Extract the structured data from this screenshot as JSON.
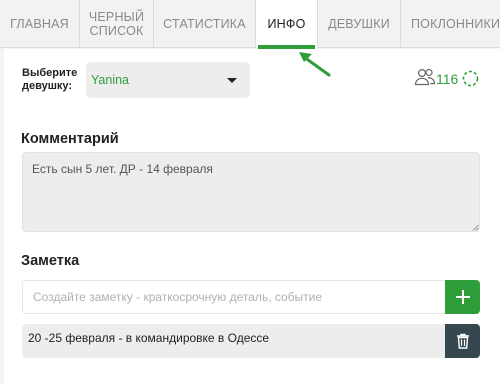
{
  "tabs": [
    {
      "label": "ГЛАВНАЯ",
      "active": false
    },
    {
      "label": "ЧЕРНЫЙ",
      "label2": "СПИСОК",
      "active": false
    },
    {
      "label": "СТАТИСТИКА",
      "active": false
    },
    {
      "label": "ИНФО",
      "active": true
    },
    {
      "label": "ДЕВУШКИ",
      "active": false
    },
    {
      "label": "ПОКЛОННИКИ",
      "active": false
    }
  ],
  "girl_select": {
    "label": "Выберите девушку:",
    "value": "Yanina"
  },
  "stats": {
    "icon": "people-icon",
    "count": "116"
  },
  "comment": {
    "heading": "Комментарий",
    "text": "Есть сын 5 лет. ДР - 14 февраля"
  },
  "note": {
    "heading": "Заметка",
    "placeholder": "Создайте заметку - краткосрочную деталь, событие",
    "items": [
      {
        "text": "20 -25 февраля - в командировке в Одессе"
      }
    ]
  },
  "colors": {
    "accent": "#2e9e3a",
    "delete": "#37474f"
  }
}
